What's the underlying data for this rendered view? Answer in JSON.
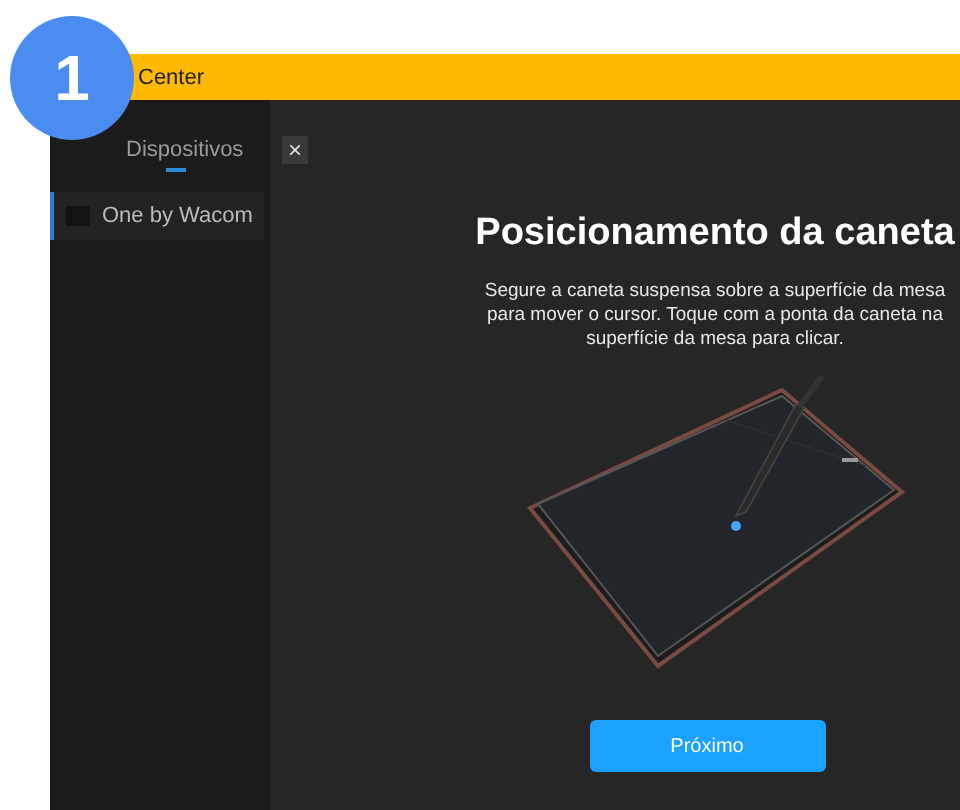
{
  "badge": {
    "text": "1"
  },
  "window": {
    "title": "Center"
  },
  "sidebar": {
    "tabs": [
      {
        "label": "Dispositivos",
        "selected": true
      }
    ],
    "devices": [
      {
        "name": "One by Wacom",
        "selected": true
      }
    ]
  },
  "dialog": {
    "close": "×",
    "title": "Posicionamento da caneta",
    "description": "Segure a caneta suspensa sobre a superfície da mesa para mover o cursor. Toque com a ponta da caneta na superfície da mesa para clicar.",
    "button": "Próximo"
  }
}
